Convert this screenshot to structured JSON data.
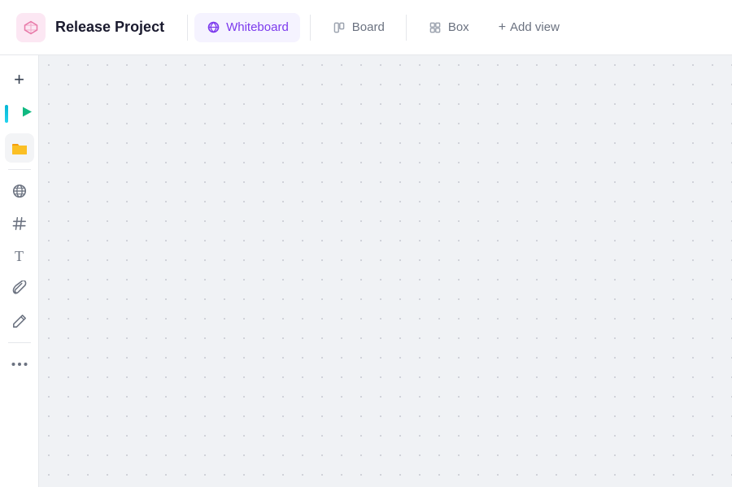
{
  "header": {
    "project_icon_alt": "box-icon",
    "project_title": "Release Project",
    "tabs": [
      {
        "id": "whiteboard",
        "label": "Whiteboard",
        "active": true,
        "icon": "whiteboard-icon"
      },
      {
        "id": "board",
        "label": "Board",
        "active": false,
        "icon": "board-icon"
      },
      {
        "id": "box",
        "label": "Box",
        "active": false,
        "icon": "box-view-icon"
      }
    ],
    "add_view_label": "Add view"
  },
  "sidebar": {
    "items": [
      {
        "id": "add",
        "icon": "+",
        "label": "add-item",
        "active": false
      },
      {
        "id": "globe",
        "icon": "🌐",
        "label": "globe-icon",
        "active": false
      },
      {
        "id": "hash",
        "icon": "#",
        "label": "hash-icon",
        "active": false
      },
      {
        "id": "text",
        "icon": "T",
        "label": "text-icon",
        "active": false
      },
      {
        "id": "clip",
        "icon": "📎",
        "label": "attachment-icon",
        "active": false
      },
      {
        "id": "pen",
        "icon": "✏",
        "label": "draw-icon",
        "active": false
      },
      {
        "id": "more",
        "icon": "···",
        "label": "more-icon",
        "active": false
      }
    ]
  },
  "canvas": {
    "background": "#f0f2f5"
  }
}
